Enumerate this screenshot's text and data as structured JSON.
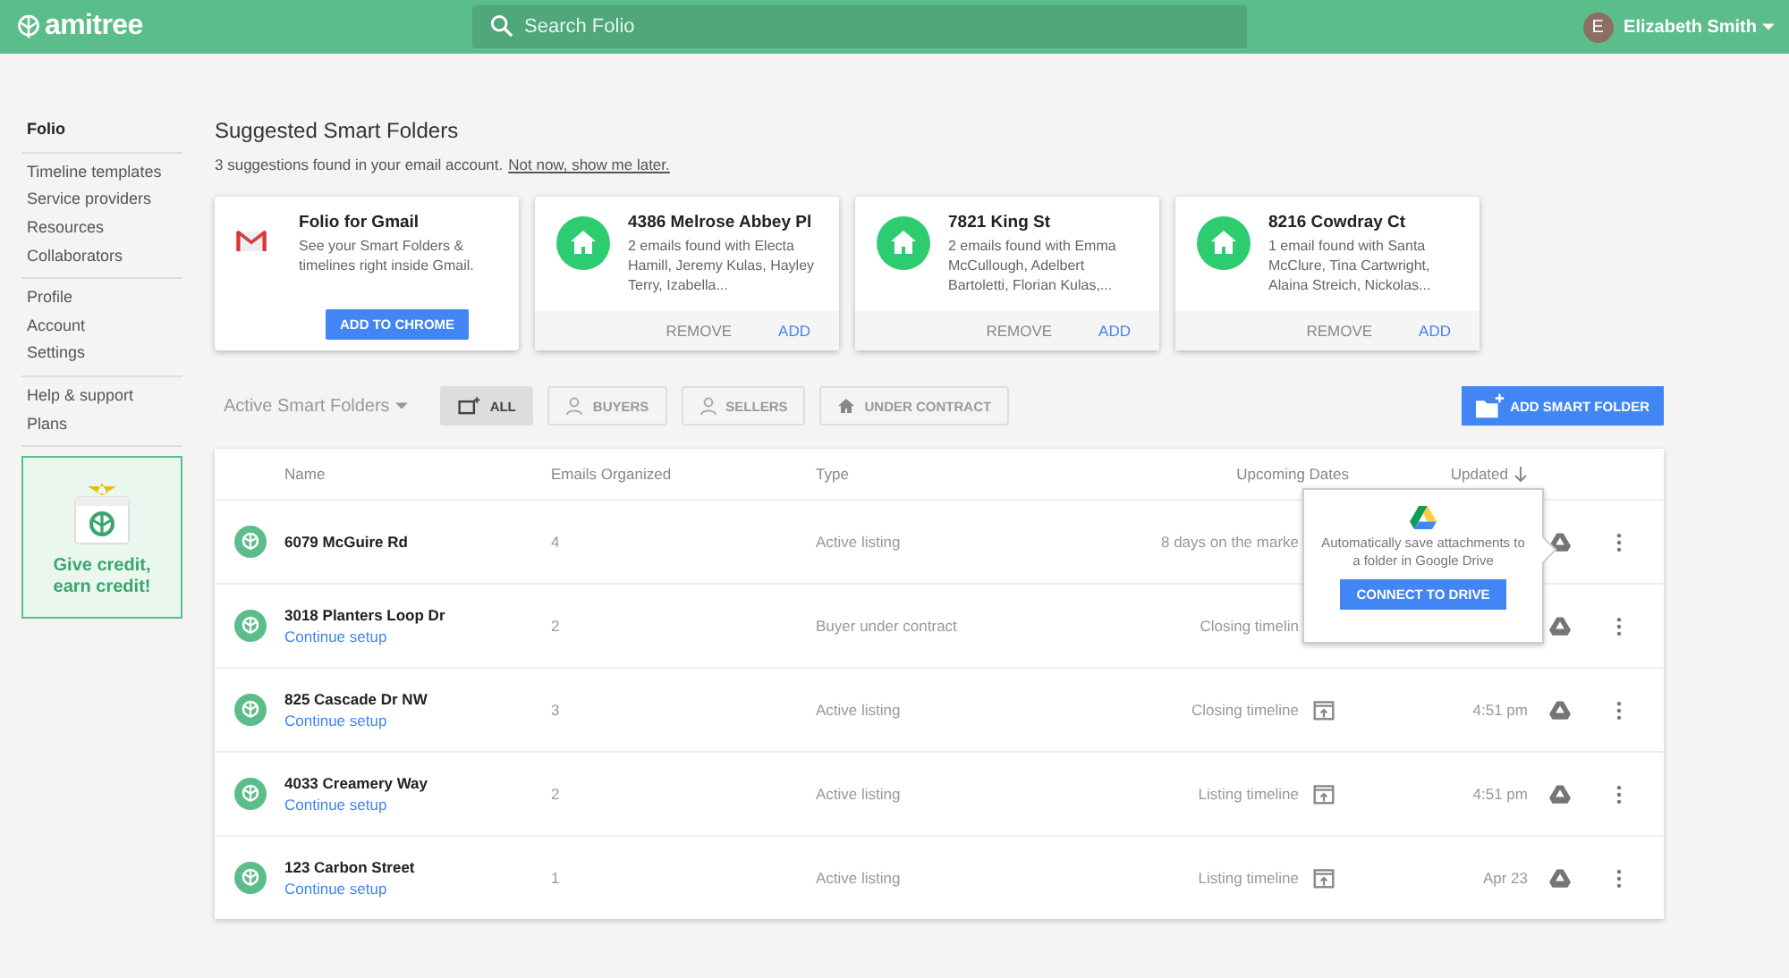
{
  "header": {
    "logo": "amitree",
    "search": {
      "placeholder": "Search Folio"
    },
    "user": {
      "initial": "E",
      "name": "Elizabeth Smith"
    }
  },
  "sidebar": {
    "groups": [
      {
        "items": [
          {
            "label": "Folio",
            "selected": true
          }
        ]
      },
      {
        "items": [
          {
            "label": "Timeline templates",
            "selected": false
          },
          {
            "label": "Service providers",
            "selected": false
          },
          {
            "label": "Resources",
            "selected": false
          },
          {
            "label": "Collaborators",
            "selected": false
          }
        ]
      },
      {
        "items": [
          {
            "label": "Profile",
            "selected": false
          },
          {
            "label": "Account",
            "selected": false
          },
          {
            "label": "Settings",
            "selected": false
          }
        ]
      },
      {
        "items": [
          {
            "label": "Help & support",
            "selected": false
          },
          {
            "label": "Plans",
            "selected": false
          }
        ]
      }
    ],
    "promo": {
      "text": "Give credit, earn credit!"
    }
  },
  "suggestions": {
    "title": "Suggested Smart Folders",
    "subtitle": "3 suggestions found in your email account.",
    "link": "Not now, show me later.",
    "cards": [
      {
        "kind": "gmail",
        "title": "Folio for Gmail",
        "description": "See your Smart Folders & timelines right inside Gmail.",
        "button": "ADD TO CHROME"
      },
      {
        "kind": "house",
        "title": "4386 Melrose Abbey Pl",
        "description": "2 emails found with Electa Hamill, Jeremy Kulas, Hayley Terry, Izabella...",
        "remove": "REMOVE",
        "add": "ADD"
      },
      {
        "kind": "house",
        "title": "7821 King St",
        "description": "2 emails found with Emma McCullough, Adelbert Bartoletti, Florian Kulas,...",
        "remove": "REMOVE",
        "add": "ADD"
      },
      {
        "kind": "house",
        "title": "8216 Cowdray Ct",
        "description": "1 email found with Santa McClure, Tina Cartwright, Alaina Streich, Nickolas...",
        "remove": "REMOVE",
        "add": "ADD"
      }
    ]
  },
  "filters": {
    "dropdown": "Active Smart Folders",
    "chips": [
      {
        "kind": "all",
        "label": "ALL",
        "selected": true
      },
      {
        "kind": "person",
        "label": "BUYERS",
        "selected": false
      },
      {
        "kind": "person",
        "label": "SELLERS",
        "selected": false
      },
      {
        "kind": "home",
        "label": "UNDER CONTRACT",
        "selected": false
      }
    ],
    "add_button": "ADD SMART FOLDER"
  },
  "table": {
    "columns": [
      "Name",
      "Emails Organized",
      "Type",
      "Upcoming Dates",
      "Updated"
    ],
    "rows": [
      {
        "name": "6079 McGuire Rd",
        "emails": "4",
        "type": "Active listing",
        "upcoming": "8 days on the marke",
        "upcoming_icon": false
      },
      {
        "name": "3018 Planters Loop Dr",
        "setup": "Continue setup",
        "emails": "2",
        "type": "Buyer under contract",
        "upcoming": "Closing timelin",
        "upcoming_icon": false
      },
      {
        "name": "825 Cascade Dr NW",
        "setup": "Continue setup",
        "emails": "3",
        "type": "Active listing",
        "upcoming": "Closing timeline",
        "upcoming_icon": true,
        "updated": "4:51 pm"
      },
      {
        "name": "4033 Creamery Way",
        "setup": "Continue setup",
        "emails": "2",
        "type": "Active listing",
        "upcoming": "Listing timeline",
        "upcoming_icon": true,
        "updated": "4:51 pm"
      },
      {
        "name": "123 Carbon Street",
        "setup": "Continue setup",
        "emails": "1",
        "type": "Active listing",
        "upcoming": "Listing timeline",
        "upcoming_icon": true,
        "updated": "Apr 23"
      }
    ]
  },
  "popover": {
    "text": "Automatically save attachments to a folder in Google Drive",
    "button": "CONNECT TO DRIVE"
  }
}
